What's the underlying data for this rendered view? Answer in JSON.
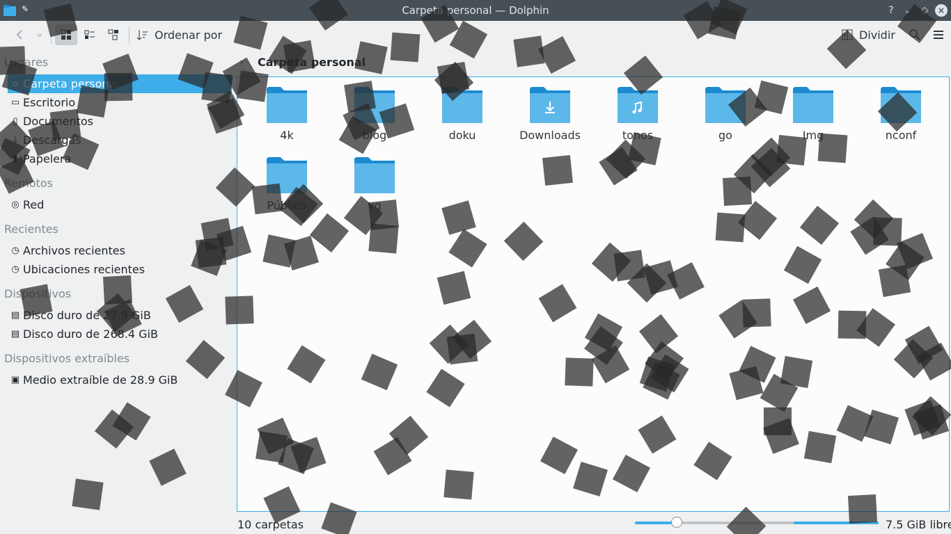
{
  "window": {
    "title": "Carpeta personal — Dolphin",
    "buttons": [
      "?",
      "⌄",
      "◇",
      "×"
    ]
  },
  "toolbar": {
    "sort_label": "Ordenar por",
    "split_label": "Dividir"
  },
  "sidebar": {
    "sections": [
      {
        "title": "Lugares",
        "items": [
          {
            "label": "Carpeta personal",
            "icon": "home-icon",
            "selected": true
          },
          {
            "label": "Escritorio",
            "icon": "desktop-icon"
          },
          {
            "label": "Documentos",
            "icon": "documents-icon"
          },
          {
            "label": "Descargas",
            "icon": "download-icon"
          },
          {
            "label": "Papelera",
            "icon": "trash-icon"
          }
        ]
      },
      {
        "title": "Remotos",
        "items": [
          {
            "label": "Red",
            "icon": "network-icon"
          }
        ]
      },
      {
        "title": "Recientes",
        "items": [
          {
            "label": "Archivos recientes",
            "icon": "recent-files-icon"
          },
          {
            "label": "Ubicaciones recientes",
            "icon": "recent-locations-icon"
          }
        ]
      },
      {
        "title": "Dispositivos",
        "items": [
          {
            "label": "Disco duro de 27.9 GiB",
            "icon": "hard-disk-icon"
          },
          {
            "label": "Disco duro de 268.4 GiB",
            "icon": "hard-disk-icon"
          }
        ]
      },
      {
        "title": "Dispositivos extraíbles",
        "items": [
          {
            "label": "Medio extraíble de 28.9 GiB",
            "icon": "removable-media-icon"
          }
        ]
      }
    ]
  },
  "location": {
    "crumb": "Carpeta personal"
  },
  "folders": [
    {
      "name": "4k",
      "type": "folder"
    },
    {
      "name": "blog",
      "type": "folder"
    },
    {
      "name": "doku",
      "type": "folder"
    },
    {
      "name": "Downloads",
      "type": "downloads"
    },
    {
      "name": "tonos",
      "type": "music"
    },
    {
      "name": "go",
      "type": "folder"
    },
    {
      "name": "Img",
      "type": "folder"
    },
    {
      "name": "nconf",
      "type": "folder"
    },
    {
      "name": "Público",
      "type": "folder"
    },
    {
      "name": "vg",
      "type": "folder"
    }
  ],
  "status": {
    "count": "10 carpetas",
    "free": "7.5 GiB libre",
    "zoom_level": 0.17,
    "free_fraction": 0.35
  },
  "colors": {
    "accent": "#3daee9",
    "titlebar": "#475057",
    "folder": "#5cb8e8",
    "folder_tab": "#1d8bd1"
  }
}
